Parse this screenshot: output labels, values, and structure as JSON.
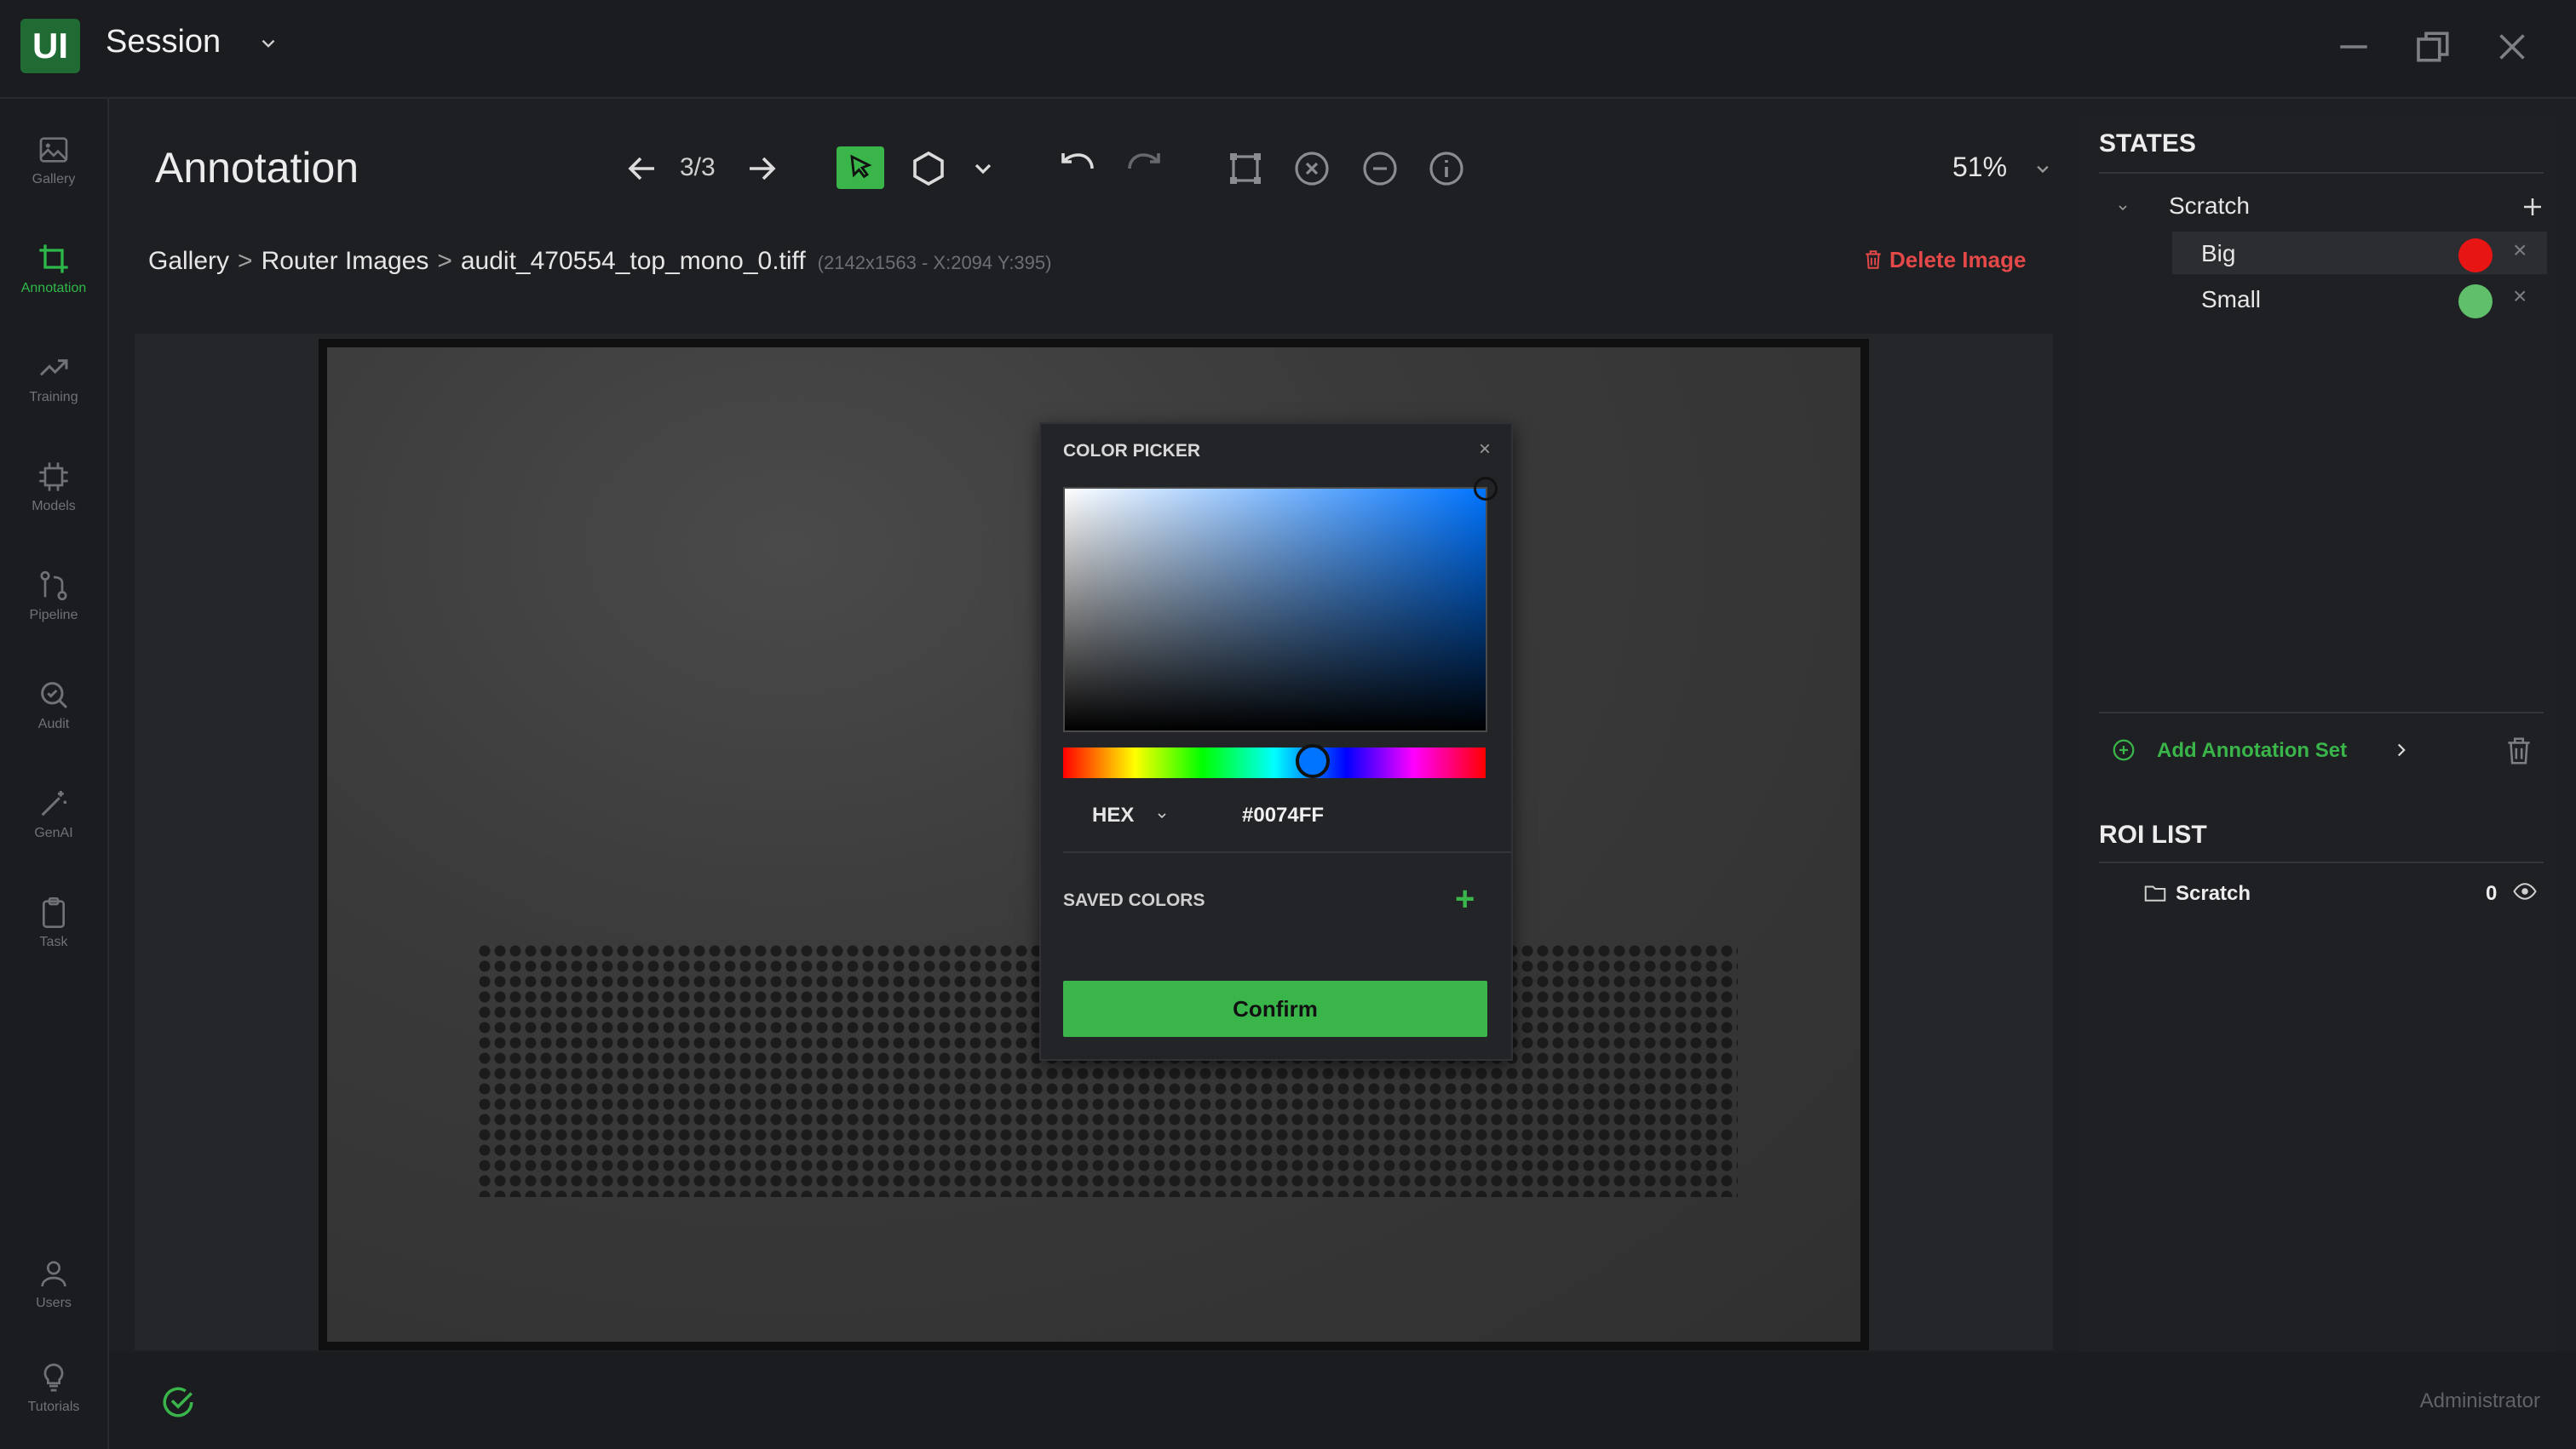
{
  "app": {
    "logo_text": "UI",
    "session_title": "Session"
  },
  "sidebar": {
    "items": [
      {
        "label": "Gallery"
      },
      {
        "label": "Annotation"
      },
      {
        "label": "Training"
      },
      {
        "label": "Models"
      },
      {
        "label": "Pipeline"
      },
      {
        "label": "Audit"
      },
      {
        "label": "GenAI"
      },
      {
        "label": "Task"
      },
      {
        "label": "Users"
      },
      {
        "label": "Tutorials"
      }
    ],
    "active": "Annotation"
  },
  "toolbar": {
    "title": "Annotation",
    "counter": "3/3",
    "zoom": "51%"
  },
  "breadcrumb": {
    "items": [
      "Gallery",
      "Router Images",
      "audit_470554_top_mono_0.tiff"
    ],
    "separator": ">",
    "meta": "(2142x1563 - X:2094 Y:395)"
  },
  "delete_image_label": "Delete Image",
  "color_picker": {
    "title": "COLOR PICKER",
    "close": "×",
    "format": "HEX",
    "hex_value": "#0074FF",
    "saved_colors_label": "SAVED COLORS",
    "add_symbol": "+",
    "confirm_label": "Confirm",
    "hue_fraction": 0.59
  },
  "states": {
    "heading": "STATES",
    "group": "Scratch",
    "items": [
      {
        "name": "Big",
        "color": "#e81515",
        "x": "×"
      },
      {
        "name": "Small",
        "color": "#5fbf6a",
        "x": "×"
      }
    ],
    "add_annotation_set": "Add Annotation Set"
  },
  "roi_list": {
    "heading": "ROI LIST",
    "items": [
      {
        "name": "Scratch",
        "count": "0"
      }
    ]
  },
  "footer": {
    "user": "Administrator"
  },
  "colors": {
    "accent": "#3ab54a",
    "danger": "#e54848",
    "background": "#1e1f22"
  }
}
